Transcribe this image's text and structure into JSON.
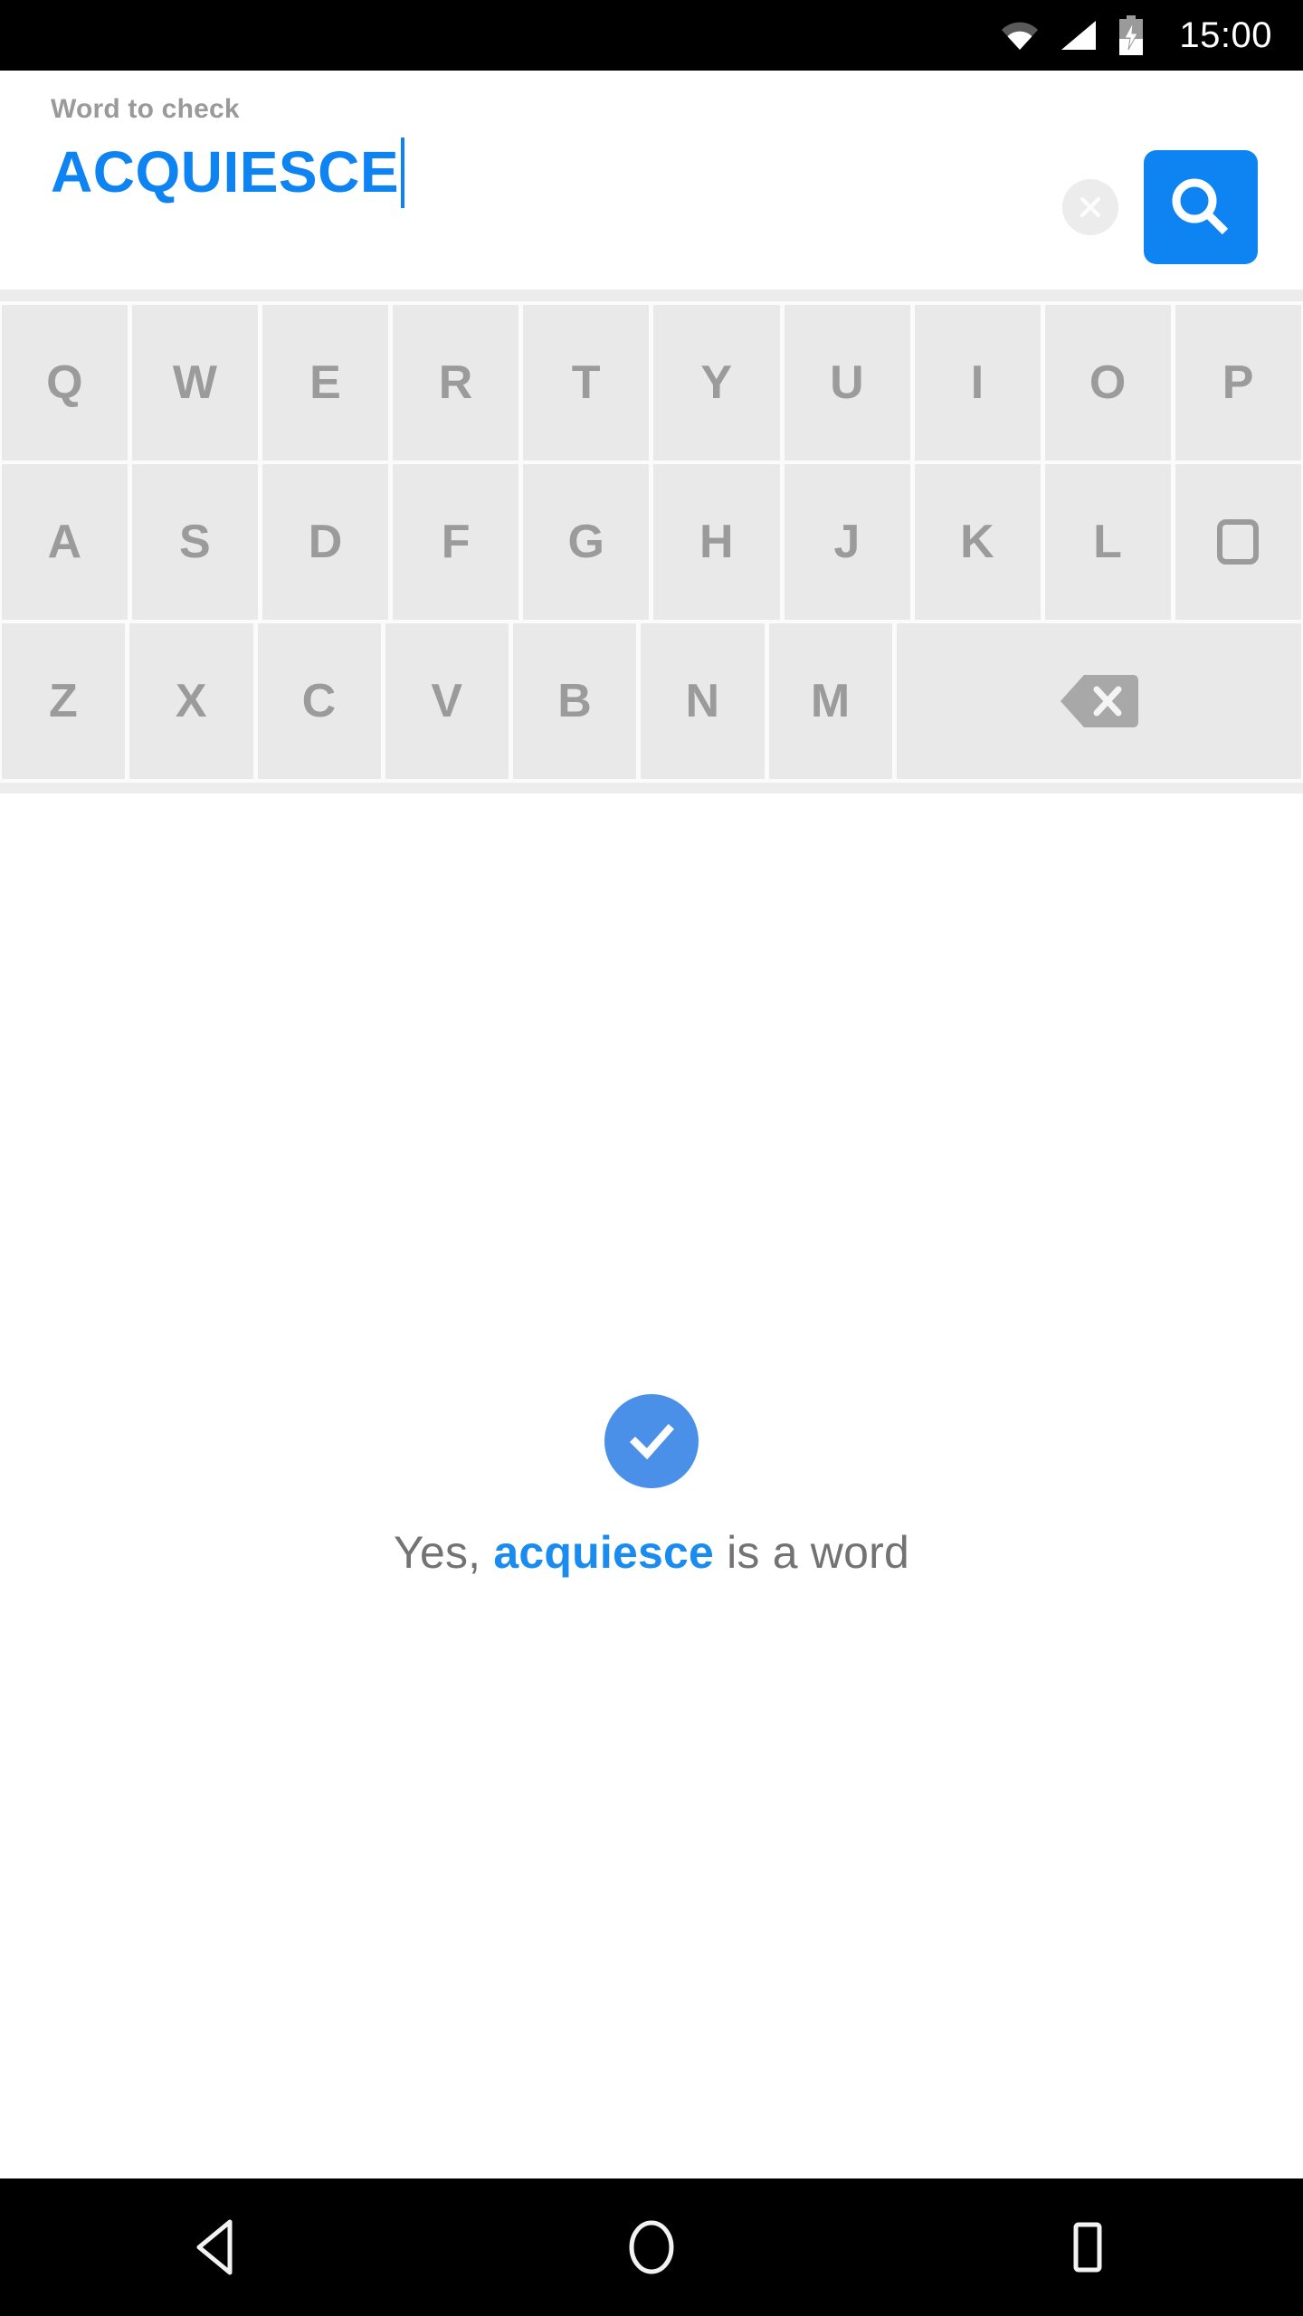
{
  "status_bar": {
    "time": "15:00",
    "icons": [
      "wifi-icon",
      "cellular-signal-icon",
      "battery-charging-icon"
    ],
    "background": "#000000",
    "foreground": "#ffffff"
  },
  "search_header": {
    "label": "Word to check",
    "value": "ACQUIESCE",
    "placeholder": "Word to check",
    "accent_color": "#0d84f2",
    "label_color": "#9a9a9a",
    "clear_button": {
      "icon": "close-circle-icon",
      "background": "#ececec"
    },
    "search_button": {
      "icon": "search-icon",
      "background": "#0d84f2"
    }
  },
  "keyboard": {
    "background": "#fbfbfb",
    "key_color": "#e9e9e9",
    "key_text_color": "#9b9b9b",
    "rows": [
      {
        "keys": [
          {
            "label": "Q",
            "type": "letter"
          },
          {
            "label": "W",
            "type": "letter"
          },
          {
            "label": "E",
            "type": "letter"
          },
          {
            "label": "R",
            "type": "letter"
          },
          {
            "label": "T",
            "type": "letter"
          },
          {
            "label": "Y",
            "type": "letter"
          },
          {
            "label": "U",
            "type": "letter"
          },
          {
            "label": "I",
            "type": "letter"
          },
          {
            "label": "O",
            "type": "letter"
          },
          {
            "label": "P",
            "type": "letter"
          }
        ]
      },
      {
        "keys": [
          {
            "label": "A",
            "type": "letter"
          },
          {
            "label": "S",
            "type": "letter"
          },
          {
            "label": "D",
            "type": "letter"
          },
          {
            "label": "F",
            "type": "letter"
          },
          {
            "label": "G",
            "type": "letter"
          },
          {
            "label": "H",
            "type": "letter"
          },
          {
            "label": "J",
            "type": "letter"
          },
          {
            "label": "K",
            "type": "letter"
          },
          {
            "label": "L",
            "type": "letter"
          },
          {
            "label": "",
            "type": "icon",
            "icon": "rounded-square-icon"
          }
        ]
      },
      {
        "keys": [
          {
            "label": "Z",
            "type": "letter"
          },
          {
            "label": "X",
            "type": "letter"
          },
          {
            "label": "C",
            "type": "letter"
          },
          {
            "label": "V",
            "type": "letter"
          },
          {
            "label": "B",
            "type": "letter"
          },
          {
            "label": "N",
            "type": "letter"
          },
          {
            "label": "M",
            "type": "letter"
          },
          {
            "label": "",
            "type": "backspace",
            "icon": "backspace-icon"
          }
        ]
      }
    ]
  },
  "result": {
    "status_icon": "check-circle-icon",
    "status_color": "#4a90e8",
    "text_before": "Yes, ",
    "word": "acquiesce",
    "text_after": " is a word",
    "text_color": "#737373",
    "word_color": "#1a8cf0"
  },
  "nav_bar": {
    "background": "#000000",
    "buttons": [
      {
        "name": "back",
        "icon": "back-triangle-icon"
      },
      {
        "name": "home",
        "icon": "home-circle-icon"
      },
      {
        "name": "recents",
        "icon": "recents-square-icon"
      }
    ]
  }
}
